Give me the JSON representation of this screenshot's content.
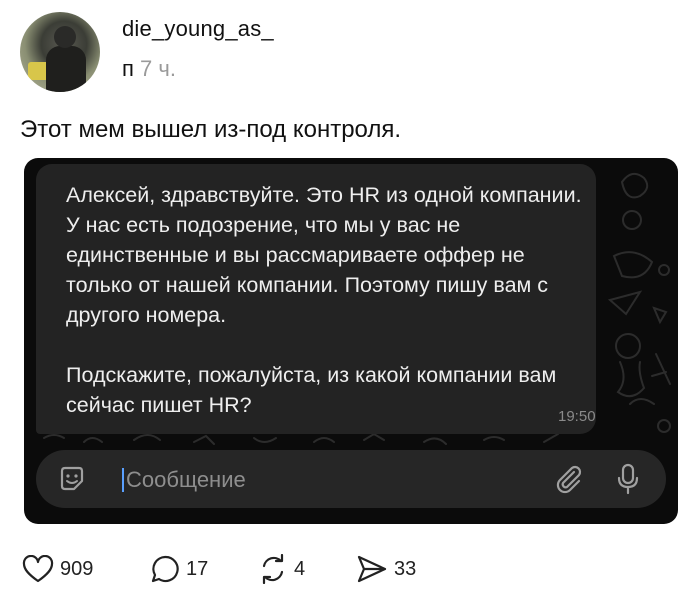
{
  "post": {
    "username": "die_young_as_",
    "meta_prefix": "п",
    "time_ago": "7 ч.",
    "text": "Этот мем вышел из-под контроля."
  },
  "chat": {
    "message_paragraphs": [
      "Алексей, здравствуйте. Это HR из одной компании. У нас есть подозрение, что мы у вас не единственные и вы рассмариваете оффер не только от нашей компании. Поэтому пишу вам с другого номера.",
      "Подскажите, пожалуйста, из какой компании вам сейчас пишет HR?"
    ],
    "message_time": "19:50",
    "input_placeholder": "Сообщение",
    "icons": [
      "sticker-icon",
      "attach-icon",
      "mic-icon"
    ]
  },
  "actions": {
    "likes": "909",
    "comments": "17",
    "reposts": "4",
    "shares": "33",
    "icons": [
      "heart-icon",
      "comment-icon",
      "repost-icon",
      "share-icon"
    ]
  },
  "colors": {
    "chat_background": "#0b0b0b",
    "bubble": "#232323",
    "input_bar": "#262626",
    "caret": "#5aa0ff"
  }
}
